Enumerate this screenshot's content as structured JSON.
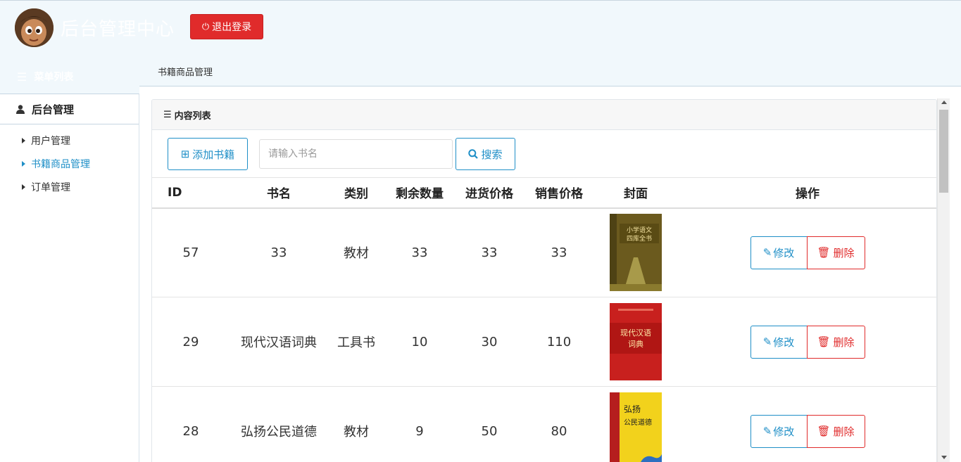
{
  "header": {
    "title": "后台管理中心",
    "logout_label": "退出登录",
    "logout_icon": "power-icon",
    "avatar_icon": "user-avatar"
  },
  "sidebar": {
    "heading": "菜单列表",
    "group_label": "后台管理",
    "items": [
      {
        "label": "用户管理",
        "active": false
      },
      {
        "label": "书籍商品管理",
        "active": true
      },
      {
        "label": "订单管理",
        "active": false
      }
    ]
  },
  "breadcrumb": "书籍商品管理",
  "panel": {
    "title": "内容列表",
    "add_label": "添加书籍",
    "search_placeholder": "请输入书名",
    "search_label": "搜索"
  },
  "table": {
    "headers": [
      "ID",
      "书名",
      "类别",
      "剩余数量",
      "进货价格",
      "销售价格",
      "封面",
      "操作"
    ],
    "rows": [
      {
        "id": "57",
        "name": "33",
        "category": "教材",
        "stock": "33",
        "cost": "33",
        "price": "33",
        "cover_title": "小学语文四库全书",
        "cover_color": "#6b5a1e"
      },
      {
        "id": "29",
        "name": "现代汉语词典",
        "category": "工具书",
        "stock": "10",
        "cost": "30",
        "price": "110",
        "cover_title": "现代汉语词典",
        "cover_color": "#c8201e"
      },
      {
        "id": "28",
        "name": "弘扬公民道德",
        "category": "教材",
        "stock": "9",
        "cost": "50",
        "price": "80",
        "cover_title": "弘扬公民道德",
        "cover_color": "#f2d21c"
      }
    ],
    "edit_label": "修改",
    "delete_label": "删除"
  },
  "colors": {
    "accent": "#1f8fc7",
    "danger": "#e02b2b",
    "header_bg": "#f1f8fc"
  }
}
